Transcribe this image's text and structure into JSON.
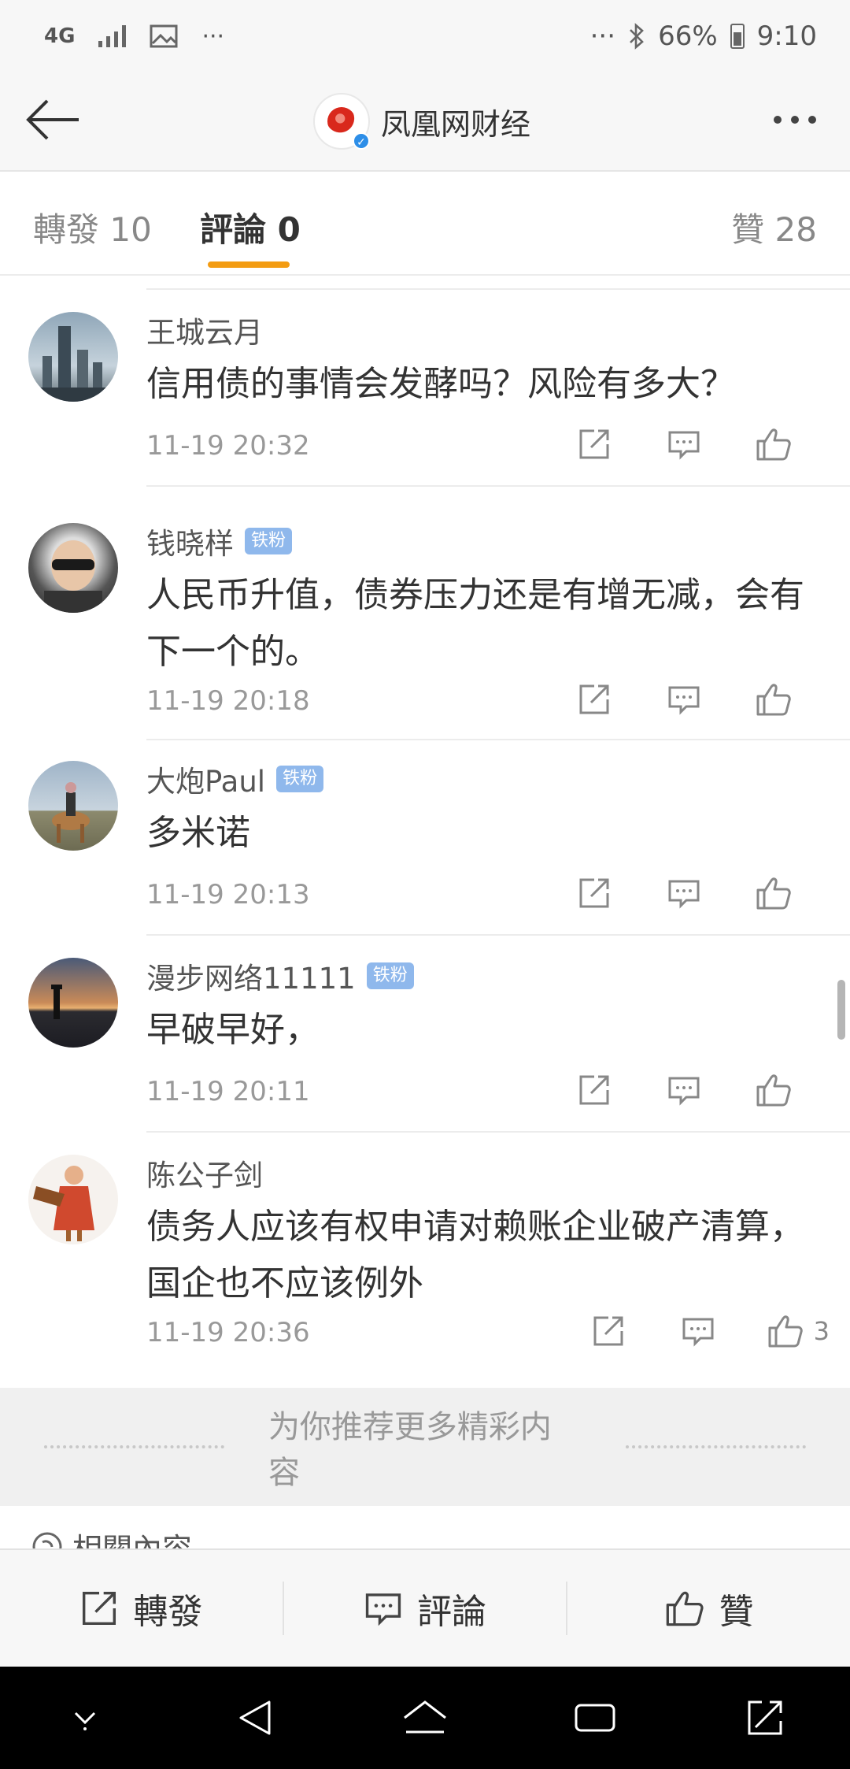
{
  "status_bar": {
    "network": "4G",
    "overflow": "···",
    "right_overflow": "···",
    "battery": "66%",
    "time": "9:10"
  },
  "nav": {
    "account_name": "凤凰网财经",
    "icons": {
      "back": "back-arrow-icon",
      "more": "more-dots-icon"
    }
  },
  "tabs": {
    "repost": "轉發 10",
    "comment": "評論 0",
    "like": "贊 28"
  },
  "comments": [
    {
      "name": "王城云月",
      "badge": "",
      "text": "信用债的事情会发酵吗？风险有多大？",
      "time": "11-19 20:32",
      "likes": ""
    },
    {
      "name": "钱晓样",
      "badge": "铁粉",
      "text": "人民币升值，债券压力还是有增无减，会有下一个的。",
      "time": "11-19 20:18",
      "likes": ""
    },
    {
      "name": "大炮Paul",
      "badge": "铁粉",
      "text": "多米诺",
      "time": "11-19 20:13",
      "likes": ""
    },
    {
      "name": "漫步网络11111",
      "badge": "铁粉",
      "text": "早破早好，",
      "time": "11-19 20:11",
      "likes": ""
    },
    {
      "name": "陈公子剑",
      "badge": "",
      "text": "债务人应该有权申请对赖账企业破产清算，国企也不应该例外",
      "time": "11-19 20:36",
      "likes": "3"
    }
  ],
  "recommend": {
    "text": "为你推荐更多精彩内容"
  },
  "related": {
    "text": "相關內容"
  },
  "bottom_bar": {
    "repost": "轉發",
    "comment": "評論",
    "like": "贊"
  }
}
